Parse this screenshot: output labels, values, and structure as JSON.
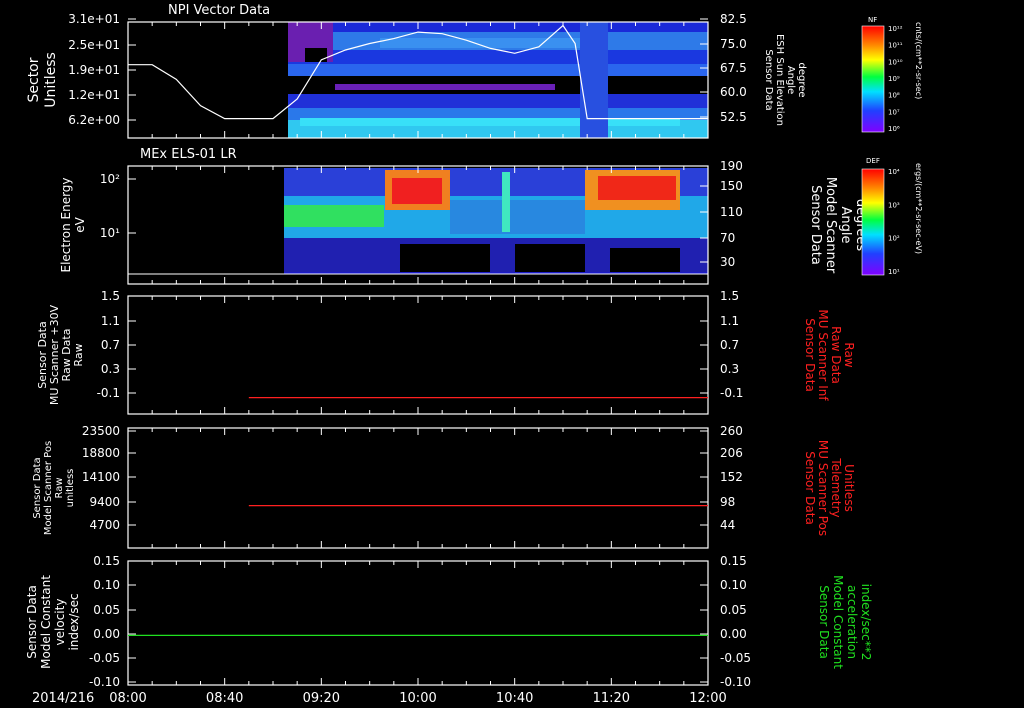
{
  "colors": {
    "white": "#ffffff",
    "red": "#ff2020",
    "green": "#20e020",
    "bg": "#000000"
  },
  "panels": {
    "p1": {
      "title": "NPI Vector Data",
      "ylabel": [
        "Sector",
        "Unitless"
      ],
      "yticks": [
        "3.1e+01",
        "2.5e+01",
        "1.9e+01",
        "1.2e+01",
        "6.2e+00"
      ],
      "rlabel": [
        "Sensor Data",
        "ESH Sun Elevation",
        "Angle",
        "degree"
      ],
      "rticks": [
        "82.5",
        "75.0",
        "67.5",
        "60.0",
        "52.5"
      ],
      "cbar_title": "NF",
      "cbar_ticks": [
        "10¹²",
        "10¹¹",
        "10¹⁰",
        "10⁹",
        "10⁸",
        "10⁷",
        "10⁶"
      ],
      "cbar_units": "cnts/(cm**2-sr-sec)"
    },
    "p2": {
      "title": "MEx ELS-01 LR",
      "ylabel": [
        "Electron Energy",
        "eV"
      ],
      "yticks": [
        "10²",
        "10¹"
      ],
      "rlabel": [
        "Sensor Data",
        "Model Scanner",
        "Angle",
        "degrees"
      ],
      "rticks": [
        "190",
        "150",
        "110",
        "70",
        "30"
      ],
      "cbar_title": "DEF",
      "cbar_ticks": [
        "10⁴",
        "10³",
        "10²",
        "10¹"
      ],
      "cbar_units": "ergs/(cm**2-sr-sec-eV)"
    },
    "p3": {
      "ylabel": [
        "Sensor Data",
        "MU Scanner +30V",
        "Raw Data",
        "Raw"
      ],
      "yticks": [
        "1.5",
        "1.1",
        "0.7",
        "0.3",
        "-0.1"
      ],
      "rlabel": [
        "Sensor Data",
        "MU Scanner Inf",
        "Raw Data",
        "Raw"
      ],
      "rticks": [
        "1.5",
        "1.1",
        "0.7",
        "0.3",
        "-0.1"
      ]
    },
    "p4": {
      "ylabel": [
        "Sensor Data",
        "Model Scanner Pos",
        "Raw",
        "unitless"
      ],
      "yticks": [
        "23500",
        "18800",
        "14100",
        "9400",
        "4700"
      ],
      "rlabel": [
        "Sensor Data",
        "MU Scanner Pos",
        "Telemetry",
        "Unitless"
      ],
      "rticks": [
        "260",
        "206",
        "152",
        "98",
        "44"
      ]
    },
    "p5": {
      "ylabel": [
        "Sensor Data",
        "Model Constant",
        "velocity",
        "index/sec"
      ],
      "yticks": [
        "0.15",
        "0.10",
        "0.05",
        "0.00",
        "-0.05",
        "-0.10"
      ],
      "rlabel": [
        "Sensor Data",
        "Model Constant",
        "acceleration",
        "index/sec**2"
      ],
      "rticks": [
        "0.15",
        "0.10",
        "0.05",
        "0.00",
        "-0.05",
        "-0.10"
      ]
    }
  },
  "xaxis": {
    "date_label": "2014/216",
    "ticks": [
      "08:00",
      "08:40",
      "09:20",
      "10:00",
      "10:40",
      "11:20",
      "12:00"
    ]
  },
  "chart_data": [
    {
      "type": "heatmap",
      "title": "NPI Vector Data",
      "ylabel": "Sector Unitless",
      "x_range": [
        "08:00",
        "12:00"
      ],
      "data_start": "08:55",
      "overlay_line": {
        "name": "ESH Sun Elevation Angle",
        "x": [
          "08:00",
          "08:10",
          "08:20",
          "08:30",
          "08:40",
          "08:50",
          "09:00",
          "09:10",
          "09:20",
          "09:30",
          "09:40",
          "09:50",
          "10:00",
          "10:10",
          "10:20",
          "10:30",
          "10:40",
          "10:50",
          "11:00",
          "11:05",
          "11:10",
          "11:20",
          "11:40",
          "12:00"
        ],
        "y": [
          68.5,
          68.5,
          64,
          56,
          52,
          52,
          52,
          58,
          70,
          73,
          75,
          76.5,
          78.5,
          78,
          76,
          73.5,
          72,
          74,
          80.5,
          75,
          52,
          52,
          52,
          52
        ]
      }
    },
    {
      "type": "heatmap",
      "title": "MEx ELS-01 LR",
      "ylabel": "Electron Energy eV",
      "x_range": [
        "08:00",
        "12:00"
      ],
      "data_start": "08:55"
    },
    {
      "type": "line",
      "ylim": [
        -0.3,
        1.5
      ],
      "series": [
        {
          "x": [
            "08:50",
            "12:00"
          ],
          "y": [
            -0.05,
            -0.05
          ]
        }
      ]
    },
    {
      "type": "line",
      "ylim": [
        0,
        23500
      ],
      "series": [
        {
          "x": [
            "08:50",
            "12:00"
          ],
          "y": [
            8300,
            8300
          ]
        }
      ]
    },
    {
      "type": "line",
      "ylim": [
        -0.1,
        0.15
      ],
      "series": [
        {
          "x": [
            "08:00",
            "12:00"
          ],
          "y": [
            0.0,
            0.0
          ]
        }
      ]
    }
  ]
}
